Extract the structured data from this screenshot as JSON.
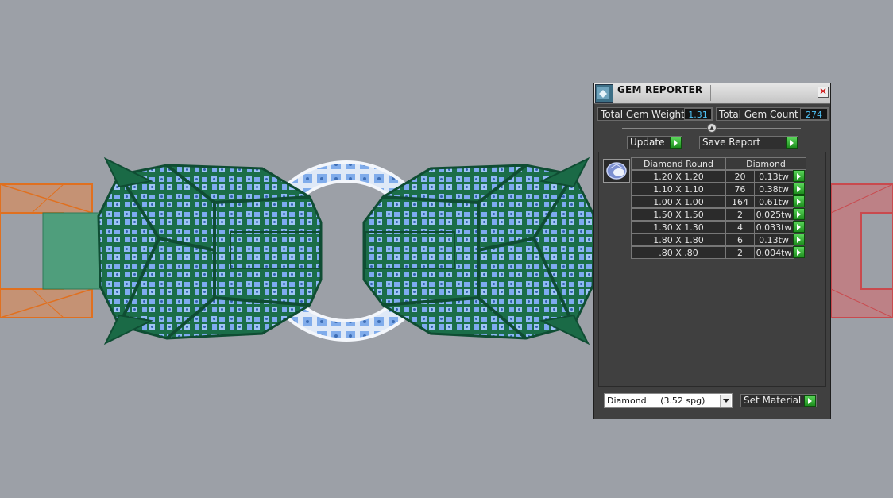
{
  "window": {
    "title": "GEM REPORTER",
    "close_glyph": "✕"
  },
  "summary": {
    "weight_label": "Total Gem Weight",
    "weight_value": "1.31",
    "count_label": "Total Gem Count",
    "count_value": "274"
  },
  "toolbar": {
    "update_label": "Update",
    "save_report_label": "Save Report"
  },
  "table": {
    "headers": [
      "Diamond Round",
      "Diamond"
    ],
    "rows": [
      {
        "size": "1.20 X 1.20",
        "count": "20",
        "weight": "0.13tw"
      },
      {
        "size": "1.10 X 1.10",
        "count": "76",
        "weight": "0.38tw"
      },
      {
        "size": "1.00 X 1.00",
        "count": "164",
        "weight": "0.61tw"
      },
      {
        "size": "1.50 X 1.50",
        "count": "2",
        "weight": "0.025tw"
      },
      {
        "size": "1.30 X 1.30",
        "count": "4",
        "weight": "0.033tw"
      },
      {
        "size": "1.80 X 1.80",
        "count": "6",
        "weight": "0.13tw"
      },
      {
        "size": ".80 X .80",
        "count": "2",
        "weight": "0.004tw"
      }
    ]
  },
  "material": {
    "selected": "Diamond     (3.52 spg)",
    "set_label": "Set Material"
  },
  "icons": {
    "app": "gem-reporter-icon",
    "gem": "round-diamond-icon",
    "run": "green-play-icon",
    "dropdown": "chevron-down-icon"
  },
  "colors": {
    "viewport_bg": "#9ca0a7",
    "model_green": "#1f7a52",
    "stone_blue": "#86b4f0",
    "value_text": "#4fc3f7",
    "button_green": "#2fa52f"
  }
}
